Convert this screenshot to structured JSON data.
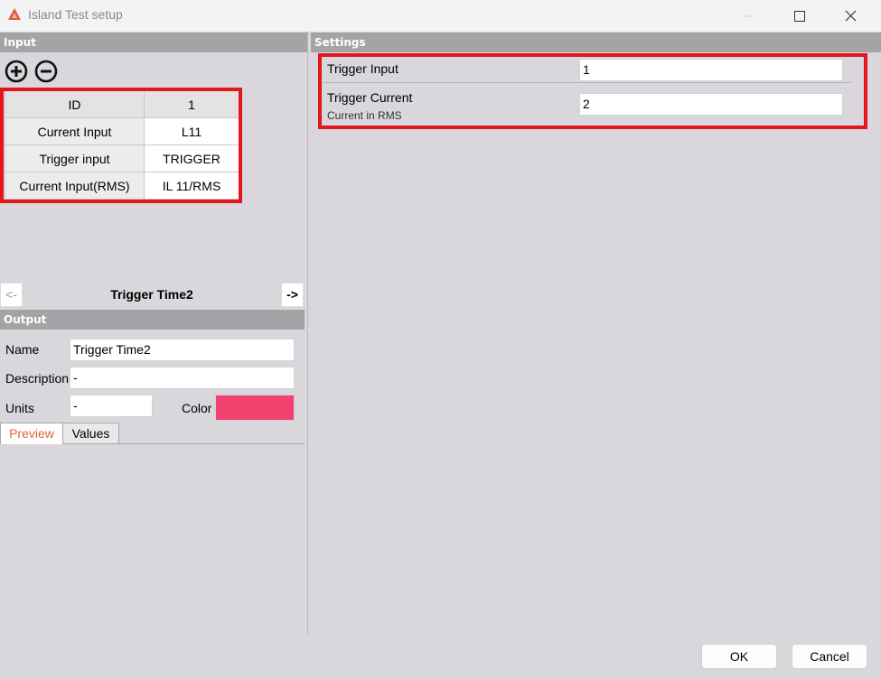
{
  "window": {
    "title": "Island Test setup",
    "minimize_glyph": "—",
    "maximize_glyph": "☐",
    "close_glyph": "✕"
  },
  "input_section": {
    "header": "Input",
    "table": {
      "header": {
        "key": "ID",
        "value": "1"
      },
      "rows": [
        {
          "key": "Current Input",
          "value": "L11"
        },
        {
          "key": "Trigger input",
          "value": "TRIGGER"
        },
        {
          "key": "Current Input(RMS)",
          "value": "IL 11/RMS"
        }
      ]
    }
  },
  "navigator": {
    "prev_label": "<-",
    "title": "Trigger Time2",
    "next_label": "->"
  },
  "output_section": {
    "header": "Output",
    "name_label": "Name",
    "name_value": "Trigger Time2",
    "description_label": "Description",
    "description_value": "-",
    "units_label": "Units",
    "units_value": "-",
    "color_label": "Color",
    "color_value": "#f2416f",
    "tabs": [
      "Preview",
      "Values"
    ],
    "active_tab": "Preview"
  },
  "settings_section": {
    "header": "Settings",
    "trigger_input_label": "Trigger Input",
    "trigger_input_value": "1",
    "trigger_current_label": "Trigger Current",
    "trigger_current_sublabel": "Current in RMS",
    "trigger_current_value": "2"
  },
  "footer": {
    "ok_label": "OK",
    "cancel_label": "Cancel"
  },
  "colors": {
    "highlight_red": "#e4161b",
    "section_header_bg": "#a4a3a5",
    "app_icon": "#e05a3a",
    "active_tab_text": "#e0643a"
  }
}
